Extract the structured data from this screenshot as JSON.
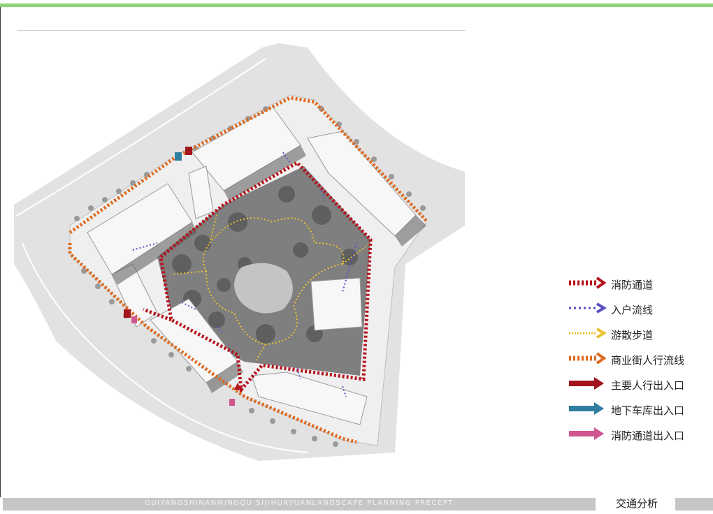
{
  "legend": [
    {
      "key": "fire",
      "label": "消防通道",
      "color": "#b5121b",
      "style": "dashed-thick"
    },
    {
      "key": "household",
      "label": "入户流线",
      "color": "#5b4fc4",
      "style": "dotted"
    },
    {
      "key": "stroll",
      "label": "游散步道",
      "color": "#eac12e",
      "style": "dotted-thin"
    },
    {
      "key": "commercial",
      "label": "商业街人行流线",
      "color": "#dd6a1f",
      "style": "dashed-thick"
    },
    {
      "key": "main-entry",
      "label": "主要人行出入口",
      "color": "#a3141c",
      "style": "arrow"
    },
    {
      "key": "garage",
      "label": "地下车库出入口",
      "color": "#2f7ea0",
      "style": "arrow"
    },
    {
      "key": "fire-entry",
      "label": "消防通道出入口",
      "color": "#d0568f",
      "style": "arrow"
    }
  ],
  "footer": {
    "caption": "GUIYANGSHINANMINGQU SIJIHUAYUANLANDSCAPE PLANNING  PRECEPT",
    "title": "交通分析"
  },
  "colors": {
    "accent": "#8fd27c",
    "fire": "#b5121b",
    "household": "#5b4fc4",
    "stroll": "#eac12e",
    "commercial": "#dd6a1f",
    "main_entry": "#a3141c",
    "garage": "#2f7ea0",
    "fire_entry": "#d0568f"
  }
}
